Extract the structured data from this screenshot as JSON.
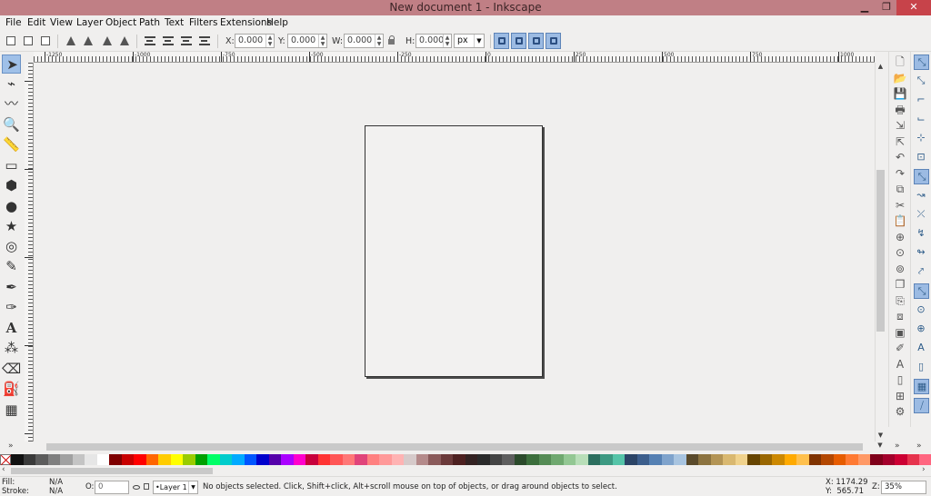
{
  "window": {
    "title": "New document 1 - Inkscape",
    "minimize_glyph": "▁",
    "maximize_glyph": "❐",
    "close_glyph": "✕"
  },
  "menu": [
    "File",
    "Edit",
    "View",
    "Layer",
    "Object",
    "Path",
    "Text",
    "Filters",
    "Extensions",
    "Help"
  ],
  "controls": {
    "x_label": "X:",
    "x_value": "0.000",
    "y_label": "Y:",
    "y_value": "0.000",
    "w_label": "W:",
    "w_value": "0.000",
    "h_label": "H:",
    "h_value": "0.000",
    "unit": "px"
  },
  "tools": [
    {
      "name": "selector-tool",
      "glyph": "➤",
      "active": true
    },
    {
      "name": "node-tool",
      "glyph": "⌁"
    },
    {
      "name": "tweak-tool",
      "glyph": "〰"
    },
    {
      "name": "zoom-tool",
      "glyph": "🔍"
    },
    {
      "name": "measure-tool",
      "glyph": "📏"
    },
    {
      "name": "rectangle-tool",
      "glyph": "▭"
    },
    {
      "name": "3d-box-tool",
      "glyph": "⬢"
    },
    {
      "name": "ellipse-tool",
      "glyph": "●"
    },
    {
      "name": "star-tool",
      "glyph": "★"
    },
    {
      "name": "spiral-tool",
      "glyph": "◎"
    },
    {
      "name": "pencil-tool",
      "glyph": "✎"
    },
    {
      "name": "pen-tool",
      "glyph": "✒"
    },
    {
      "name": "calligraphy-tool",
      "glyph": "✑"
    },
    {
      "name": "text-tool",
      "glyph": "A"
    },
    {
      "name": "spray-tool",
      "glyph": "⁂"
    },
    {
      "name": "eraser-tool",
      "glyph": "⌫"
    },
    {
      "name": "paint-bucket-tool",
      "glyph": "⛽"
    },
    {
      "name": "gradient-tool",
      "glyph": "▦"
    }
  ],
  "ruler_labels": [
    "-1250",
    "-1000",
    "-750",
    "-500",
    "-250",
    "0",
    "250",
    "500",
    "750",
    "1000",
    "1250",
    "1500",
    "1750"
  ],
  "commands": [
    {
      "name": "new-document-icon",
      "glyph": "🗋"
    },
    {
      "name": "open-document-icon",
      "glyph": "📂"
    },
    {
      "name": "save-document-icon",
      "glyph": "💾"
    },
    {
      "name": "print-icon",
      "glyph": "🖶"
    },
    {
      "name": "import-icon",
      "glyph": "⇲"
    },
    {
      "name": "export-icon",
      "glyph": "⇱"
    },
    {
      "name": "undo-icon",
      "glyph": "↶"
    },
    {
      "name": "redo-icon",
      "glyph": "↷"
    },
    {
      "name": "copy-icon",
      "glyph": "⧉"
    },
    {
      "name": "cut-icon",
      "glyph": "✂"
    },
    {
      "name": "paste-icon",
      "glyph": "📋"
    },
    {
      "name": "zoom-selection-icon",
      "glyph": "⊕"
    },
    {
      "name": "zoom-drawing-icon",
      "glyph": "⊙"
    },
    {
      "name": "zoom-page-icon",
      "glyph": "⊚"
    },
    {
      "name": "duplicate-icon",
      "glyph": "❐"
    },
    {
      "name": "clone-icon",
      "glyph": "⎘"
    },
    {
      "name": "unlink-clone-icon",
      "glyph": "⧈"
    },
    {
      "name": "group-icon",
      "glyph": "▣"
    },
    {
      "name": "fill-stroke-icon",
      "glyph": "✐"
    },
    {
      "name": "text-font-icon",
      "glyph": "A"
    },
    {
      "name": "xml-editor-icon",
      "glyph": "▯"
    },
    {
      "name": "align-distribute-icon",
      "glyph": "⊞"
    },
    {
      "name": "preferences-icon",
      "glyph": "⚙"
    }
  ],
  "snaps": [
    {
      "name": "snap-enable-icon",
      "glyph": "⤡",
      "on": true
    },
    {
      "name": "snap-bbox-icon",
      "glyph": "⤡"
    },
    {
      "name": "snap-bbox-edge-icon",
      "glyph": "⌐"
    },
    {
      "name": "snap-bbox-corner-icon",
      "glyph": "⌙"
    },
    {
      "name": "snap-bbox-midpoint-icon",
      "glyph": "⊹"
    },
    {
      "name": "snap-bbox-center-icon",
      "glyph": "⊡"
    },
    {
      "name": "snap-nodes-icon",
      "glyph": "⤡",
      "on": true
    },
    {
      "name": "snap-path-icon",
      "glyph": "↝"
    },
    {
      "name": "snap-intersection-icon",
      "glyph": "⤫"
    },
    {
      "name": "snap-cusp-icon",
      "glyph": "↯"
    },
    {
      "name": "snap-smooth-icon",
      "glyph": "↬"
    },
    {
      "name": "snap-midpoint-icon",
      "glyph": "⤤"
    },
    {
      "name": "snap-others-icon",
      "glyph": "⤡",
      "on": true
    },
    {
      "name": "snap-object-center-icon",
      "glyph": "⊙"
    },
    {
      "name": "snap-rotation-center-icon",
      "glyph": "⊕"
    },
    {
      "name": "snap-text-baseline-icon",
      "glyph": "A"
    },
    {
      "name": "snap-page-border-icon",
      "glyph": "▯"
    },
    {
      "name": "snap-grid-icon",
      "glyph": "▦",
      "on": true
    },
    {
      "name": "snap-guide-icon",
      "glyph": "⧸",
      "on": true
    }
  ],
  "palette": [
    "#111111",
    "#3a3a3a",
    "#5c5c5c",
    "#7f7f7f",
    "#a1a1a1",
    "#c4c4c4",
    "#e6e6e6",
    "#ffffff",
    "#7f0000",
    "#c80000",
    "#ff0000",
    "#ff6600",
    "#ffcc00",
    "#ffff00",
    "#99cc00",
    "#00a000",
    "#00ff66",
    "#00cccc",
    "#00aaff",
    "#0055ff",
    "#0000cc",
    "#5500aa",
    "#aa00ff",
    "#ff00cc",
    "#c8003c",
    "#ff3333",
    "#ff5555",
    "#ff7777",
    "#e0447a",
    "#ff8080",
    "#ff9999",
    "#ffb3b3",
    "#d6caca",
    "#b48a8a",
    "#8a5a5a",
    "#6b3a3a",
    "#4d2020",
    "#332222",
    "#2a2a2a",
    "#444444",
    "#5e5e5e",
    "#2b4a2b",
    "#3c6e3c",
    "#558b55",
    "#6fa86f",
    "#93c793",
    "#b8deb8",
    "#2c6e5e",
    "#3d9982",
    "#55c4a8",
    "#2b4466",
    "#3c5e8c",
    "#5580b3",
    "#7fa3cc",
    "#a8c4e0",
    "#5a4a2b",
    "#8c7340",
    "#b39455",
    "#d9b870",
    "#f0d28c",
    "#664400",
    "#996600",
    "#cc8800",
    "#ffaa00",
    "#ffc04d",
    "#803300",
    "#b34700",
    "#e65c00",
    "#ff7a33",
    "#ff9966",
    "#80001a",
    "#a3002b",
    "#cc0033",
    "#e6334d",
    "#ff6680"
  ],
  "palette_scroll": {
    "left_glyph": "‹",
    "right_glyph": "›"
  },
  "status": {
    "fill_label": "Fill:",
    "fill_value": "N/A",
    "stroke_label": "Stroke:",
    "stroke_value": "N/A",
    "opacity_label": "O:",
    "opacity_value": "0",
    "layer": "•Layer 1",
    "message": "No objects selected. Click, Shift+click, Alt+scroll mouse on top of objects, or drag around objects to select.",
    "x_readout": "X: 1174.29",
    "y_readout": "Y:  565.71",
    "zoom_label": "Z:",
    "zoom_value": "35%"
  }
}
